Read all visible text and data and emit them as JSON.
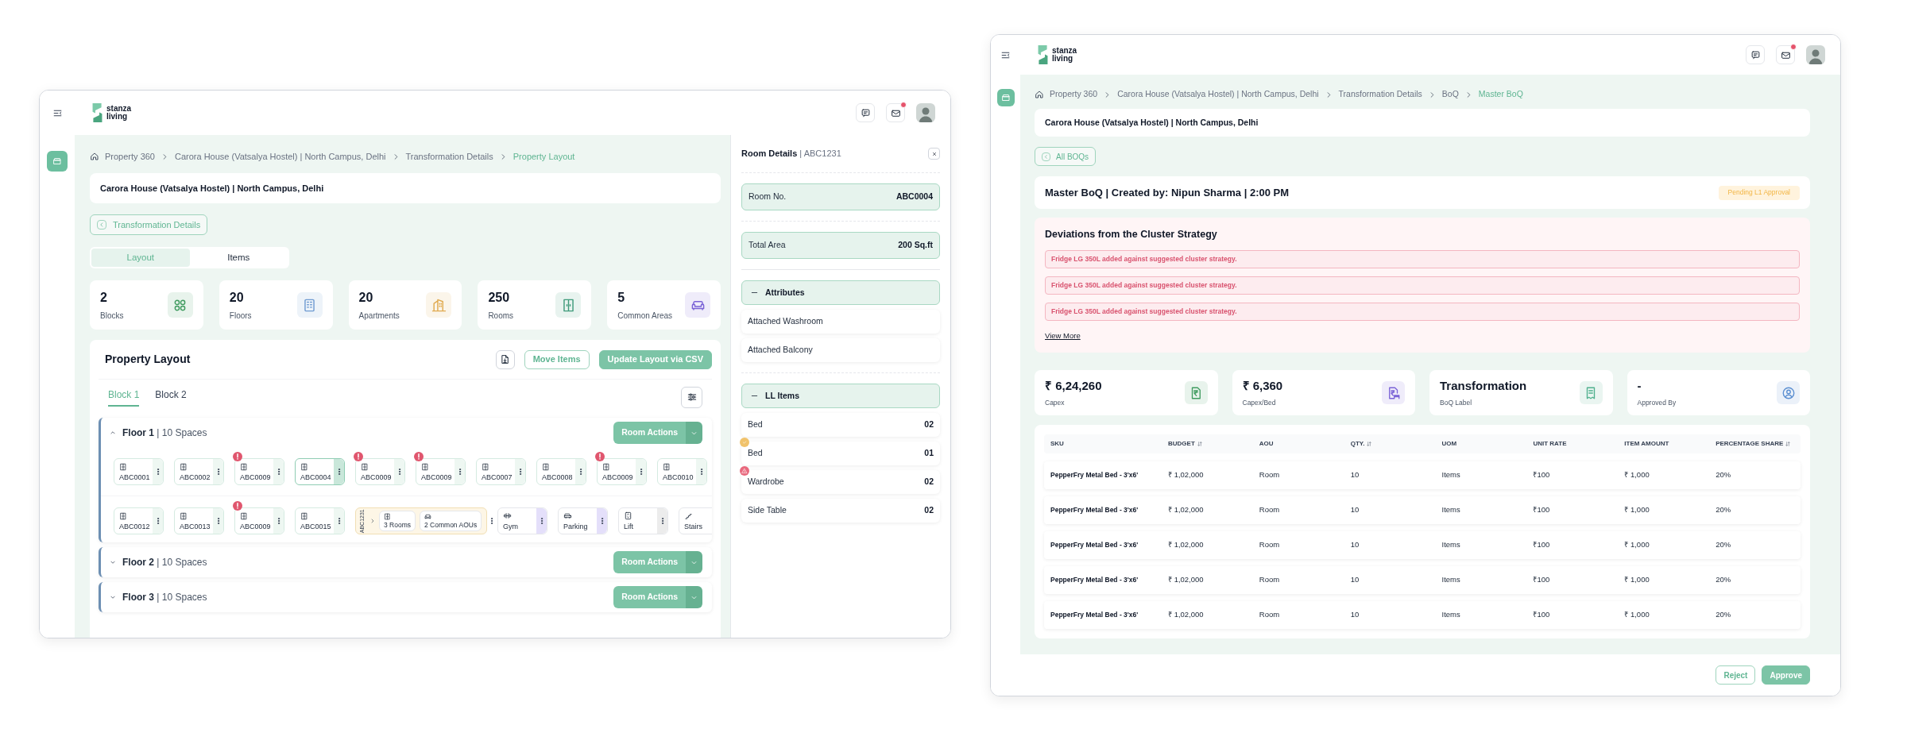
{
  "layout_window": {
    "header": {
      "logo": "stanza living",
      "icons": [
        {
          "kind": "chat",
          "badge": false
        },
        {
          "kind": "mail",
          "badge": true
        }
      ]
    },
    "sidebar": [
      {
        "kind": "store",
        "selected": true
      }
    ],
    "breadcrumb": [
      {
        "label": "Property 360",
        "current": false
      },
      {
        "label": "Carora House (Vatsalya Hostel) | North Campus, Delhi",
        "current": false
      },
      {
        "label": "Transformation Details",
        "current": false
      },
      {
        "label": "Property Layout",
        "current": true
      }
    ],
    "title": "Carora House (Vatsalya Hostel) | North Campus, Delhi",
    "back_button": "Transformation Details",
    "tabs": [
      {
        "label": "Layout",
        "selected": true
      },
      {
        "label": "Items",
        "selected": false
      }
    ],
    "stats": [
      {
        "value": "2",
        "label": "Blocks",
        "kind": "blocks",
        "color": "#3f9b5f"
      },
      {
        "value": "20",
        "label": "Floors",
        "kind": "floors",
        "color": "#6f9bd1"
      },
      {
        "value": "20",
        "label": "Apartments",
        "kind": "apartments",
        "color": "#e0aa4f"
      },
      {
        "value": "250",
        "label": "Rooms",
        "kind": "rooms",
        "color": "#3e9a7a"
      },
      {
        "value": "5",
        "label": "Common Areas",
        "kind": "common_areas",
        "color": "#7a62d6"
      }
    ],
    "property_layout": {
      "title": "Property Layout",
      "actions": [
        {
          "label": "Move Items",
          "kind": "outline"
        },
        {
          "label": "Update Layout via CSV",
          "kind": "primary"
        }
      ],
      "block_tabs": [
        {
          "label": "Block 1",
          "selected": true
        },
        {
          "label": "Block 2",
          "selected": false
        }
      ],
      "floors": [
        {
          "title": "**Floor 1** | 10 Spaces",
          "expanded": true,
          "action": "Room Actions",
          "rows": [
            {
              "items": [
                {
                  "kind": "room",
                  "label": "ABC0001",
                  "alert": false,
                  "selected": false
                },
                {
                  "kind": "room",
                  "label": "ABC0002",
                  "alert": false,
                  "selected": false
                },
                {
                  "kind": "room",
                  "label": "ABC0009",
                  "alert": true,
                  "selected": false
                },
                {
                  "kind": "room",
                  "label": "ABC0004",
                  "alert": false,
                  "selected": true
                },
                {
                  "kind": "room",
                  "label": "ABC0009",
                  "alert": true,
                  "selected": false
                },
                {
                  "kind": "room",
                  "label": "ABC0009",
                  "alert": true,
                  "selected": false
                },
                {
                  "kind": "room",
                  "label": "ABC0007",
                  "alert": false,
                  "selected": false
                },
                {
                  "kind": "room",
                  "label": "ABC0008",
                  "alert": false,
                  "selected": false
                },
                {
                  "kind": "room",
                  "label": "ABC0009",
                  "alert": true,
                  "selected": false
                },
                {
                  "kind": "room",
                  "label": "ABC0010",
                  "alert": false,
                  "selected": false
                }
              ]
            },
            {
              "items": [
                {
                  "kind": "room",
                  "label": "ABC0012",
                  "alert": false,
                  "selected": false
                },
                {
                  "kind": "room",
                  "label": "ABC0013",
                  "alert": false,
                  "selected": false
                },
                {
                  "kind": "room",
                  "label": "ABC0009",
                  "alert": true,
                  "selected": false
                },
                {
                  "kind": "room",
                  "label": "ABC0015",
                  "alert": false,
                  "selected": false
                },
                {
                  "kind": "cluster",
                  "label": "ABC1231",
                  "parts": [
                    {
                      "kind": "rooms",
                      "label": "3 Rooms"
                    },
                    {
                      "kind": "common",
                      "label": "2 Common AOUs"
                    }
                  ]
                },
                {
                  "kind": "gym",
                  "label": "Gym",
                  "color": "#e4dffa"
                },
                {
                  "kind": "parking",
                  "label": "Parking",
                  "color": "#e4dffa"
                },
                {
                  "kind": "lift",
                  "label": "Lift",
                  "color": "#ececec"
                },
                {
                  "kind": "stairs",
                  "label": "Stairs"
                }
              ]
            }
          ]
        },
        {
          "title": "**Floor 2** | 10 Spaces",
          "expanded": false,
          "action": "Room Actions"
        },
        {
          "title": "**Floor 3** | 10 Spaces",
          "expanded": false,
          "action": "Room Actions"
        }
      ]
    },
    "room_details": {
      "title": "**Room Details** | ABC1231",
      "fields": [
        {
          "label": "Room No.",
          "value": "ABC0004"
        },
        {
          "label": "Total Area",
          "value": "200 Sq.ft"
        }
      ],
      "sections": [
        {
          "title": "Attributes",
          "expanded": true,
          "items": [
            {
              "name": "Attached Washroom"
            },
            {
              "name": "Attached Balcony"
            }
          ]
        },
        {
          "title": "LL Items",
          "expanded": true,
          "items": [
            {
              "name": "Bed",
              "qty": "02",
              "kind": "plain"
            },
            {
              "name": "Bed",
              "qty": "01",
              "kind": "warning"
            },
            {
              "name": "Wardrobe",
              "qty": "02",
              "kind": "error"
            },
            {
              "name": "Side Table",
              "qty": "02",
              "kind": "plain"
            }
          ]
        }
      ]
    }
  },
  "boq_window": {
    "header": {
      "logo": "stanza living",
      "icons": [
        {
          "kind": "chat",
          "badge": false
        },
        {
          "kind": "mail",
          "badge": true
        }
      ]
    },
    "sidebar": [
      {
        "kind": "store",
        "selected": true
      }
    ],
    "breadcrumb": [
      {
        "label": "Property 360",
        "current": false
      },
      {
        "label": "Carora House (Vatsalya Hostel) | North Campus, Delhi",
        "current": false
      },
      {
        "label": "Transformation Details",
        "current": false
      },
      {
        "label": "BoQ",
        "current": false
      },
      {
        "label": "Master BoQ",
        "current": true
      }
    ],
    "title": "Carora House (Vatsalya Hostel) | North Campus, Delhi",
    "back_button": "All BOQs",
    "boq": {
      "title": "Master BoQ | Created by: Nipun Sharma | 2:00 PM",
      "status": "Pending L1 Approval"
    },
    "deviations": {
      "title": "Deviations from the Cluster Strategy",
      "messages": [
        "Fridge LG 350L added against suggested cluster strategy.",
        "Fridge LG 350L added against suggested cluster strategy.",
        "Fridge LG 350L added against suggested cluster strategy."
      ],
      "link": "View More"
    },
    "stats": [
      {
        "value": "₹ 6,24,260",
        "label": "Capex",
        "kind": "capex",
        "color": "#3f9b5f"
      },
      {
        "value": "₹ 6,360",
        "label": "Capex/Bed",
        "kind": "capex_per_bed",
        "color": "#7a62d6"
      },
      {
        "value": "Transformation",
        "label": "BoQ Label",
        "kind": "boq_label",
        "color": "#4fb08d"
      },
      {
        "value": "-",
        "label": "Approved By",
        "kind": "approver",
        "color": "#5b8fd1"
      }
    ],
    "table": {
      "columns": [
        {
          "label": "SKU",
          "sortable": false
        },
        {
          "label": "BUDGET",
          "sortable": true
        },
        {
          "label": "AOU",
          "sortable": false
        },
        {
          "label": "QTY.",
          "sortable": true
        },
        {
          "label": "UOM",
          "sortable": false
        },
        {
          "label": "UNIT RATE",
          "sortable": false
        },
        {
          "label": "ITEM AMOUNT",
          "sortable": false
        },
        {
          "label": "PERCENTAGE SHARE",
          "sortable": true
        }
      ],
      "rows": [
        [
          "PepperFry Metal Bed - 3'x6'",
          "₹ 1,02,000",
          "Room",
          "10",
          "Items",
          "₹100",
          "₹ 1,000",
          "20%"
        ],
        [
          "PepperFry Metal Bed - 3'x6'",
          "₹ 1,02,000",
          "Room",
          "10",
          "Items",
          "₹100",
          "₹ 1,000",
          "20%"
        ],
        [
          "PepperFry Metal Bed - 3'x6'",
          "₹ 1,02,000",
          "Room",
          "10",
          "Items",
          "₹100",
          "₹ 1,000",
          "20%"
        ],
        [
          "PepperFry Metal Bed - 3'x6'",
          "₹ 1,02,000",
          "Room",
          "10",
          "Items",
          "₹100",
          "₹ 1,000",
          "20%"
        ],
        [
          "PepperFry Metal Bed - 3'x6'",
          "₹ 1,02,000",
          "Room",
          "10",
          "Items",
          "₹100",
          "₹ 1,000",
          "20%"
        ]
      ]
    },
    "footer_buttons": [
      {
        "label": "Reject",
        "kind": "outline"
      },
      {
        "label": "Approve",
        "kind": "primary"
      }
    ]
  }
}
